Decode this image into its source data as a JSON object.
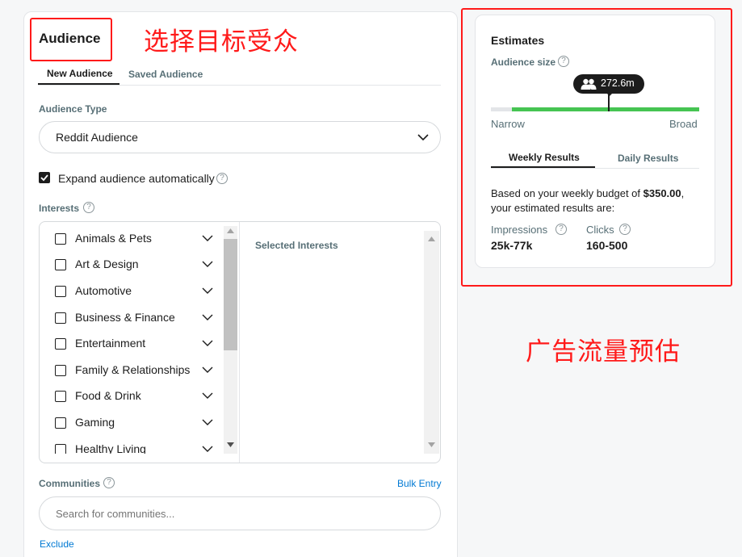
{
  "audience": {
    "title": "Audience",
    "annotation": "选择目标受众",
    "tabs": [
      {
        "label": "New Audience",
        "active": true
      },
      {
        "label": "Saved Audience",
        "active": false
      }
    ],
    "audience_type": {
      "label": "Audience Type",
      "selected": "Reddit Audience"
    },
    "expand": {
      "label": "Expand audience automatically",
      "checked": true
    },
    "interests": {
      "label": "Interests",
      "items": [
        {
          "label": "Animals & Pets"
        },
        {
          "label": "Art & Design"
        },
        {
          "label": "Automotive"
        },
        {
          "label": "Business & Finance"
        },
        {
          "label": "Entertainment"
        },
        {
          "label": "Family & Relationships"
        },
        {
          "label": "Food & Drink"
        },
        {
          "label": "Gaming"
        },
        {
          "label": "Healthy Living"
        }
      ],
      "selected_header": "Selected Interests"
    },
    "communities": {
      "label": "Communities",
      "bulk_entry": "Bulk Entry",
      "placeholder": "Search for communities...",
      "exclude": "Exclude"
    }
  },
  "estimates": {
    "title": "Estimates",
    "annotation": "广告流量预估",
    "audience_size_label": "Audience size",
    "audience_size": "272.6m",
    "range_low": "Narrow",
    "range_high": "Broad",
    "tabs": [
      {
        "label": "Weekly Results",
        "active": true
      },
      {
        "label": "Daily Results",
        "active": false
      }
    ],
    "budget_prefix": "Based on your weekly budget of ",
    "budget_amount": "$350.00",
    "budget_suffix": ", your estimated results are:",
    "impressions_label": "Impressions",
    "impressions_value": "25k-77k",
    "clicks_label": "Clicks",
    "clicks_value": "160-500"
  },
  "colors": {
    "annotation_red": "#ff1a1a",
    "accent_green": "#46c452",
    "link_blue": "#0079d3"
  }
}
